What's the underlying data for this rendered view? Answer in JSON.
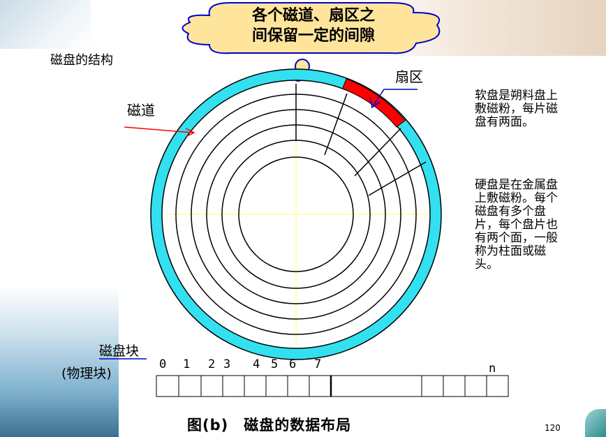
{
  "bubble": {
    "line1": "各个磁道、扇区之",
    "line2": "间保留一定的间隙"
  },
  "heading": "磁盘的结构",
  "labels": {
    "track": "磁道",
    "sector": "扇区",
    "block": "磁盘块",
    "physical": "(物理块)"
  },
  "side_text": {
    "floppy": "软盘是朔料盘上敷磁粉，每片磁盘有两面。",
    "hard": "硬盘是在金属盘上敷磁粉。每个磁盘有多个盘片，每个盘片也有两个面，一般称为柱面或磁头。"
  },
  "block_indices": [
    "0",
    "1",
    "2",
    "3",
    "4",
    "5",
    "6",
    "7",
    "n"
  ],
  "caption": "图(b)　磁盘的数据布局",
  "page_number": "120",
  "colors": {
    "track_ring": "#33e0ef",
    "sector": "#ff0000",
    "arrow_red": "#ff0000",
    "arrow_blue": "#0000cc",
    "axis": "#ffff66",
    "bubble_fill": "#ffe59c",
    "bubble_stroke": "#0000cc"
  }
}
